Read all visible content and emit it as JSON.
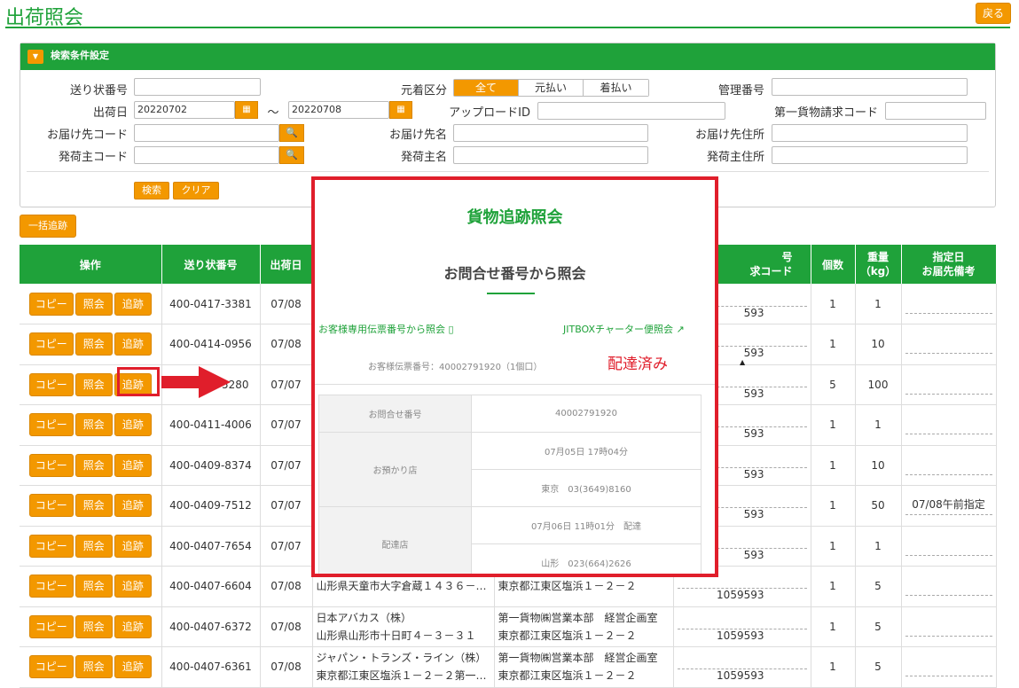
{
  "page": {
    "title": "出荷照会",
    "back_label": "戻る"
  },
  "search_panel": {
    "header": "検索条件設定",
    "labels": {
      "tracking_no": "送り状番号",
      "ship_date": "出荷日",
      "delivery_code": "お届け先コード",
      "shipper_code": "発荷主コード",
      "fare_type": "元着区分",
      "upload_id": "アップロードID",
      "delivery_name": "お届け先名",
      "shipper_name": "発荷主名",
      "mgmt_no": "管理番号",
      "billing_code": "第一貨物請求コード",
      "delivery_address": "お届け先住所",
      "shipper_address": "発荷主住所"
    },
    "date_from": "20220702",
    "date_to": "20220708",
    "tilde": "～",
    "fare_options": [
      "全て",
      "元払い",
      "着払い"
    ],
    "fare_selected": "全て",
    "search_btn": "検索",
    "clear_btn": "クリア"
  },
  "bulk_btn": "一括追跡",
  "table": {
    "headers": {
      "ops": "操作",
      "tracking": "送り状番号",
      "date": "出荷日",
      "code_top": "号",
      "code_bottom": "求コード",
      "count": "個数",
      "weight_top": "重量",
      "weight_bottom": "（kg）",
      "spec_top": "指定日",
      "spec_bottom": "お届先備考"
    },
    "action_labels": {
      "copy": "コピー",
      "inquiry": "照会",
      "track": "追跡"
    },
    "rows": [
      {
        "tracking": "400-0417-3381",
        "date": "07/08",
        "code": "593",
        "count": "1",
        "weight": "1",
        "note": "",
        "dest1": "",
        "dest2": "",
        "orig1": "",
        "orig2": ""
      },
      {
        "tracking": "400-0414-0956",
        "date": "07/08",
        "code": "593",
        "count": "1",
        "weight": "10",
        "note": "",
        "dest1": "",
        "dest2": "",
        "orig1": "",
        "orig2": ""
      },
      {
        "tracking": "5280",
        "date": "07/07",
        "code": "593",
        "count": "5",
        "weight": "100",
        "note": "",
        "dest1": "",
        "dest2": "",
        "orig1": "",
        "orig2": ""
      },
      {
        "tracking": "400-0411-4006",
        "date": "07/07",
        "code": "593",
        "count": "1",
        "weight": "1",
        "note": "",
        "dest1": "",
        "dest2": "",
        "orig1": "",
        "orig2": ""
      },
      {
        "tracking": "400-0409-8374",
        "date": "07/07",
        "code": "593",
        "count": "1",
        "weight": "10",
        "note": "",
        "dest1": "",
        "dest2": "",
        "orig1": "",
        "orig2": ""
      },
      {
        "tracking": "400-0409-7512",
        "date": "07/07",
        "code": "593",
        "count": "1",
        "weight": "50",
        "note": "07/08午前指定",
        "dest1": "",
        "dest2": "",
        "orig1": "",
        "orig2": ""
      },
      {
        "tracking": "400-0407-7654",
        "date": "07/07",
        "code": "593",
        "count": "1",
        "weight": "1",
        "note": "",
        "dest1": "",
        "dest2": "",
        "orig1": "",
        "orig2": ""
      },
      {
        "tracking": "400-0407-6604",
        "date": "07/08",
        "code": "1059593",
        "count": "1",
        "weight": "5",
        "note": "",
        "dest1": "",
        "dest2": "山形県天童市大字倉蔵１４３６－…",
        "orig1": "",
        "orig2": "東京都江東区塩浜１－２－２"
      },
      {
        "tracking": "400-0407-6372",
        "date": "07/08",
        "code": "1059593",
        "count": "1",
        "weight": "5",
        "note": "",
        "dest1": "日本アバカス（株）",
        "dest2": "山形県山形市十日町４－３－３１",
        "orig1": "第一貨物㈱営業本部　経営企画室",
        "orig2": "東京都江東区塩浜１－２－２"
      },
      {
        "tracking": "400-0407-6361",
        "date": "07/08",
        "code": "1059593",
        "count": "1",
        "weight": "5",
        "note": "",
        "dest1": "ジャパン・トランズ・ライン（株）",
        "dest2": "東京都江東区塩浜１－２－２第一…",
        "orig1": "第一貨物㈱営業本部　経営企画室",
        "orig2": "東京都江東区塩浜１－２－２"
      }
    ]
  },
  "popup": {
    "title": "貨物追跡照会",
    "subtitle": "お問合せ番号から照会",
    "link1": "お客様専用伝票番号から照会",
    "link2": "JITBOXチャーター便照会",
    "customer_no": "お客様伝票番号：40002791920（1個口）",
    "status": "配達済み",
    "rows": [
      {
        "key": "お問合せ番号",
        "val": "40002791920"
      },
      {
        "key": "お預かり店",
        "val": "07月05日 17時04分"
      },
      {
        "key": "",
        "val": "東京　03(3649)8160"
      },
      {
        "key": "配達店",
        "val": "07月06日 11時01分　配達"
      },
      {
        "key": "",
        "val": "山形　023(664)2626"
      }
    ]
  },
  "colors": {
    "brand_green": "#1fa23a",
    "accent_orange": "#f39800",
    "highlight_red": "#e01e2b"
  }
}
